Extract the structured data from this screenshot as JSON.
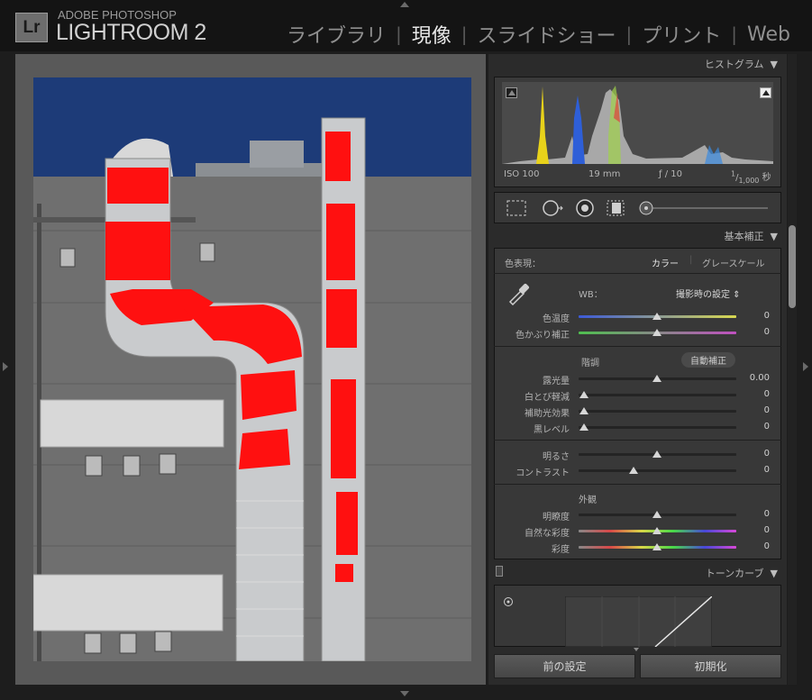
{
  "brand": {
    "logo": "Lr",
    "top": "ADOBE PHOTOSHOP",
    "main": "LIGHTROOM 2"
  },
  "modules": [
    {
      "label": "ライブラリ",
      "active": false
    },
    {
      "label": "現像",
      "active": true
    },
    {
      "label": "スライドショー",
      "active": false
    },
    {
      "label": "プリント",
      "active": false
    },
    {
      "label": "Web",
      "active": false
    }
  ],
  "histogram": {
    "title": "ヒストグラム",
    "iso": "ISO 100",
    "focal": "19 mm",
    "aperture": "ƒ / 10",
    "shutter_num": "1",
    "shutter_den": "1,000",
    "shutter_unit": "秒"
  },
  "basic": {
    "title": "基本補正",
    "treatment_label": "色表現：",
    "treatment_color": "カラー",
    "treatment_bw": "グレースケール",
    "wb_label": "WB：",
    "wb_value": "撮影時の設定 ⇕",
    "tone_label": "階調",
    "auto_label": "自動補正",
    "presence_label": "外観",
    "sliders": [
      {
        "label": "色温度",
        "value": "0",
        "pos": 0.5
      },
      {
        "label": "色かぶり補正",
        "value": "0",
        "pos": 0.5
      },
      {
        "label": "露光量",
        "value": "0.00",
        "pos": 0.5
      },
      {
        "label": "白とび軽減",
        "value": "0",
        "pos": 0.0
      },
      {
        "label": "補助光効果",
        "value": "0",
        "pos": 0.0
      },
      {
        "label": "黒レベル",
        "value": "0",
        "pos": 0.0
      },
      {
        "label": "明るさ",
        "value": "0",
        "pos": 0.5
      },
      {
        "label": "コントラスト",
        "value": "0",
        "pos": 0.35
      },
      {
        "label": "明瞭度",
        "value": "0",
        "pos": 0.5
      },
      {
        "label": "自然な彩度",
        "value": "0",
        "pos": 0.5
      },
      {
        "label": "彩度",
        "value": "0",
        "pos": 0.5
      }
    ]
  },
  "tone_curve": {
    "title": "トーンカーブ"
  },
  "buttons": {
    "previous": "前の設定",
    "reset": "初期化"
  },
  "colors": {
    "clipping": "#ff0000",
    "sky": "#1b3a7a",
    "panel": "#383838"
  }
}
